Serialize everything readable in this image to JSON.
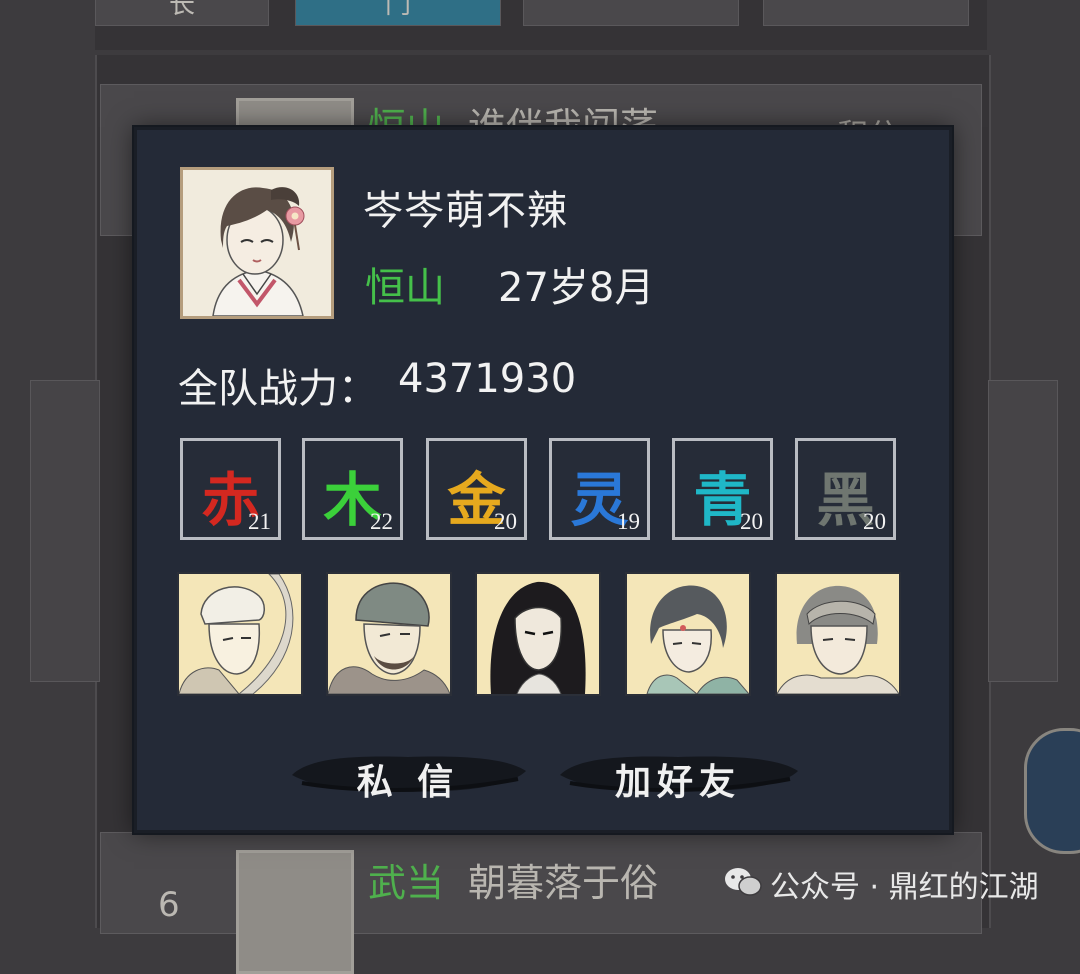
{
  "background": {
    "tabs": [
      {
        "label": "长",
        "active": false
      },
      {
        "label": "门",
        "active": true
      },
      {
        "label": "",
        "active": false
      },
      {
        "label": "",
        "active": false
      }
    ],
    "row_top": {
      "faction": "恒山",
      "name": "谁伴我闯荡",
      "score_label": "积分"
    },
    "row_bottom": {
      "rank": "6",
      "faction": "武当",
      "name": "朝暮落于俗",
      "sub_left": "",
      "sub_right": "",
      "score": ""
    }
  },
  "player": {
    "name": "岑岑萌不辣",
    "faction": "恒山",
    "age": "27岁8月",
    "power_label": "全队战力：",
    "power_value": "4371930"
  },
  "elements": [
    {
      "char": "赤",
      "value": "21",
      "color": "#d42820"
    },
    {
      "char": "木",
      "value": "22",
      "color": "#3bd03a"
    },
    {
      "char": "金",
      "value": "20",
      "color": "#e6a91e"
    },
    {
      "char": "灵",
      "value": "19",
      "color": "#2a78d8"
    },
    {
      "char": "青",
      "value": "20",
      "color": "#1fb7c7"
    },
    {
      "char": "黑",
      "value": "20",
      "color": "#6f7670"
    }
  ],
  "heroes": [
    {
      "icon": "hero-fur-hat-portrait"
    },
    {
      "icon": "hero-helmet-beard-portrait"
    },
    {
      "icon": "hero-long-hair-portrait"
    },
    {
      "icon": "hero-female-portrait"
    },
    {
      "icon": "hero-headband-portrait"
    }
  ],
  "actions": {
    "message": "私 信",
    "add_friend": "加好友"
  },
  "watermark": "公众号 · 鼎红的江湖"
}
